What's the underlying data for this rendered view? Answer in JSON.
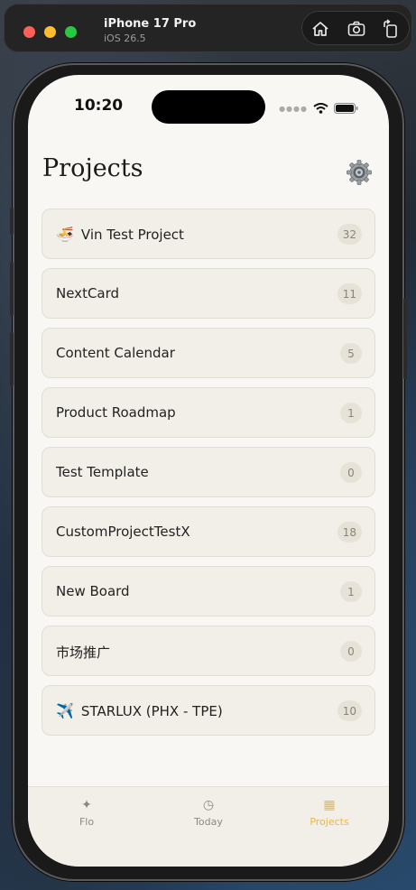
{
  "simulator": {
    "device": "iPhone 17 Pro",
    "os": "iOS 26.5",
    "tools": [
      {
        "icon": "home-icon"
      },
      {
        "icon": "screenshot-icon"
      },
      {
        "icon": "rotate-icon"
      }
    ]
  },
  "status_bar": {
    "time": "10:20",
    "icons": [
      "signal-icon",
      "wifi-icon",
      "battery-icon"
    ]
  },
  "header": {
    "title": "Projects",
    "settings_icon": "gear-icon"
  },
  "projects": [
    {
      "emoji": "🍜",
      "name": "Vin Test Project",
      "count": "32"
    },
    {
      "emoji": "",
      "name": "NextCard",
      "count": "11"
    },
    {
      "emoji": "",
      "name": "Content Calendar",
      "count": "5"
    },
    {
      "emoji": "",
      "name": "Product Roadmap",
      "count": "1"
    },
    {
      "emoji": "",
      "name": "Test Template",
      "count": "0"
    },
    {
      "emoji": "",
      "name": "CustomProjectTestX",
      "count": "18"
    },
    {
      "emoji": "",
      "name": "New Board",
      "count": "1"
    },
    {
      "emoji": "",
      "name": "市场推广",
      "count": "0"
    },
    {
      "emoji": "✈️",
      "name": "STARLUX (PHX - TPE)",
      "count": "10"
    }
  ],
  "tabbar": {
    "tabs": [
      {
        "label": "Flo",
        "icon": "sparkle-icon",
        "active": false
      },
      {
        "label": "Today",
        "icon": "clock-icon",
        "active": false
      },
      {
        "label": "Projects",
        "icon": "grid-icon",
        "active": true
      }
    ],
    "accent": "#e8b64c"
  }
}
